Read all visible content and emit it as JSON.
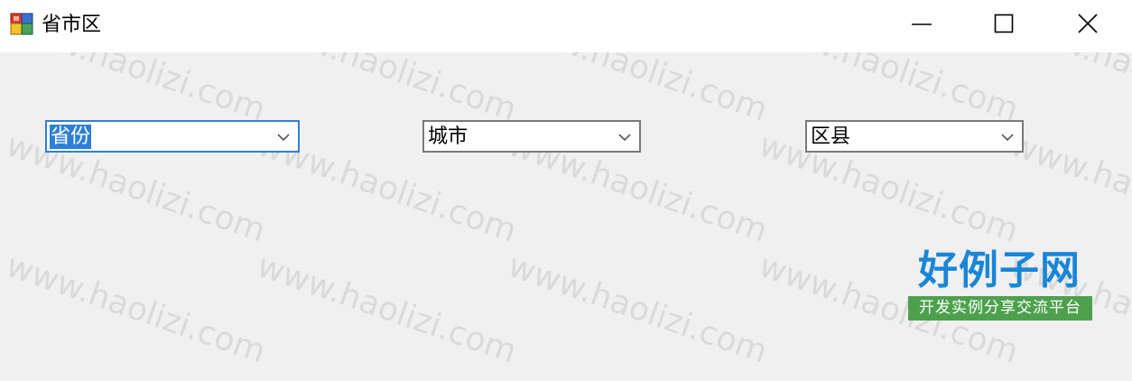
{
  "window": {
    "title": "省市区",
    "icon": "winforms-app-icon",
    "controls": [
      "minimize-icon",
      "maximize-icon",
      "close-icon"
    ]
  },
  "combos": {
    "province": {
      "value": "省份",
      "focused": true
    },
    "city": {
      "value": "城市"
    },
    "district": {
      "value": "区县"
    }
  },
  "watermark": {
    "text": "www.haolizi.com"
  },
  "logo": {
    "main": "好例子网",
    "sub": "开发实例分享交流平台"
  },
  "colors": {
    "accent": "#2f7fd8",
    "client_bg": "#f0f0f0",
    "logo_blue": "#1a86d6",
    "logo_green": "#4da14d"
  }
}
